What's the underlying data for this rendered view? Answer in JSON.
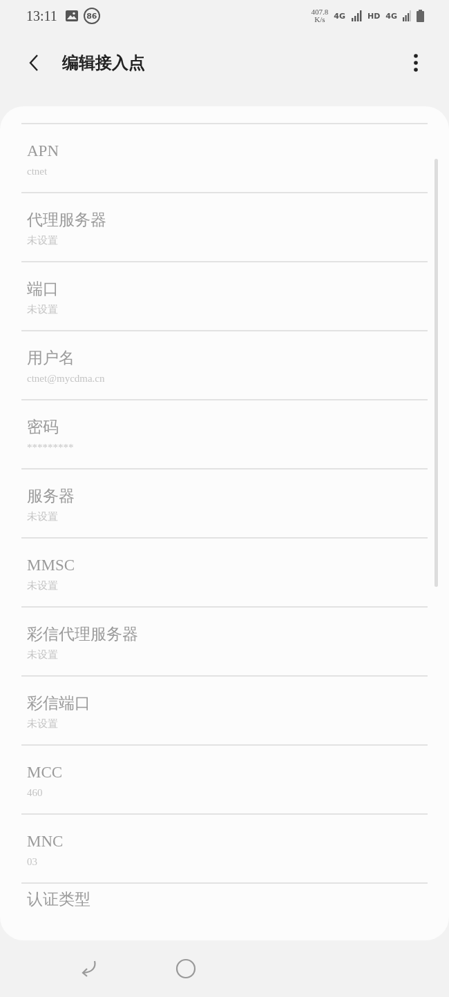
{
  "status_bar": {
    "time": "13:11",
    "badge": "86",
    "speed": "407.8",
    "speed_unit": "K/s",
    "network_1": "4G",
    "hd": "HD",
    "network_2": "4G"
  },
  "header": {
    "title": "编辑接入点"
  },
  "fields": [
    {
      "label": "APN",
      "value": "ctnet"
    },
    {
      "label": "代理服务器",
      "value": "未设置"
    },
    {
      "label": "端口",
      "value": "未设置"
    },
    {
      "label": "用户名",
      "value": "ctnet@mycdma.cn"
    },
    {
      "label": "密码",
      "value": "*********"
    },
    {
      "label": "服务器",
      "value": "未设置"
    },
    {
      "label": "MMSC",
      "value": "未设置"
    },
    {
      "label": "彩信代理服务器",
      "value": "未设置"
    },
    {
      "label": "彩信端口",
      "value": "未设置"
    },
    {
      "label": "MCC",
      "value": "460"
    },
    {
      "label": "MNC",
      "value": "03"
    },
    {
      "label": "认证类型"
    }
  ]
}
